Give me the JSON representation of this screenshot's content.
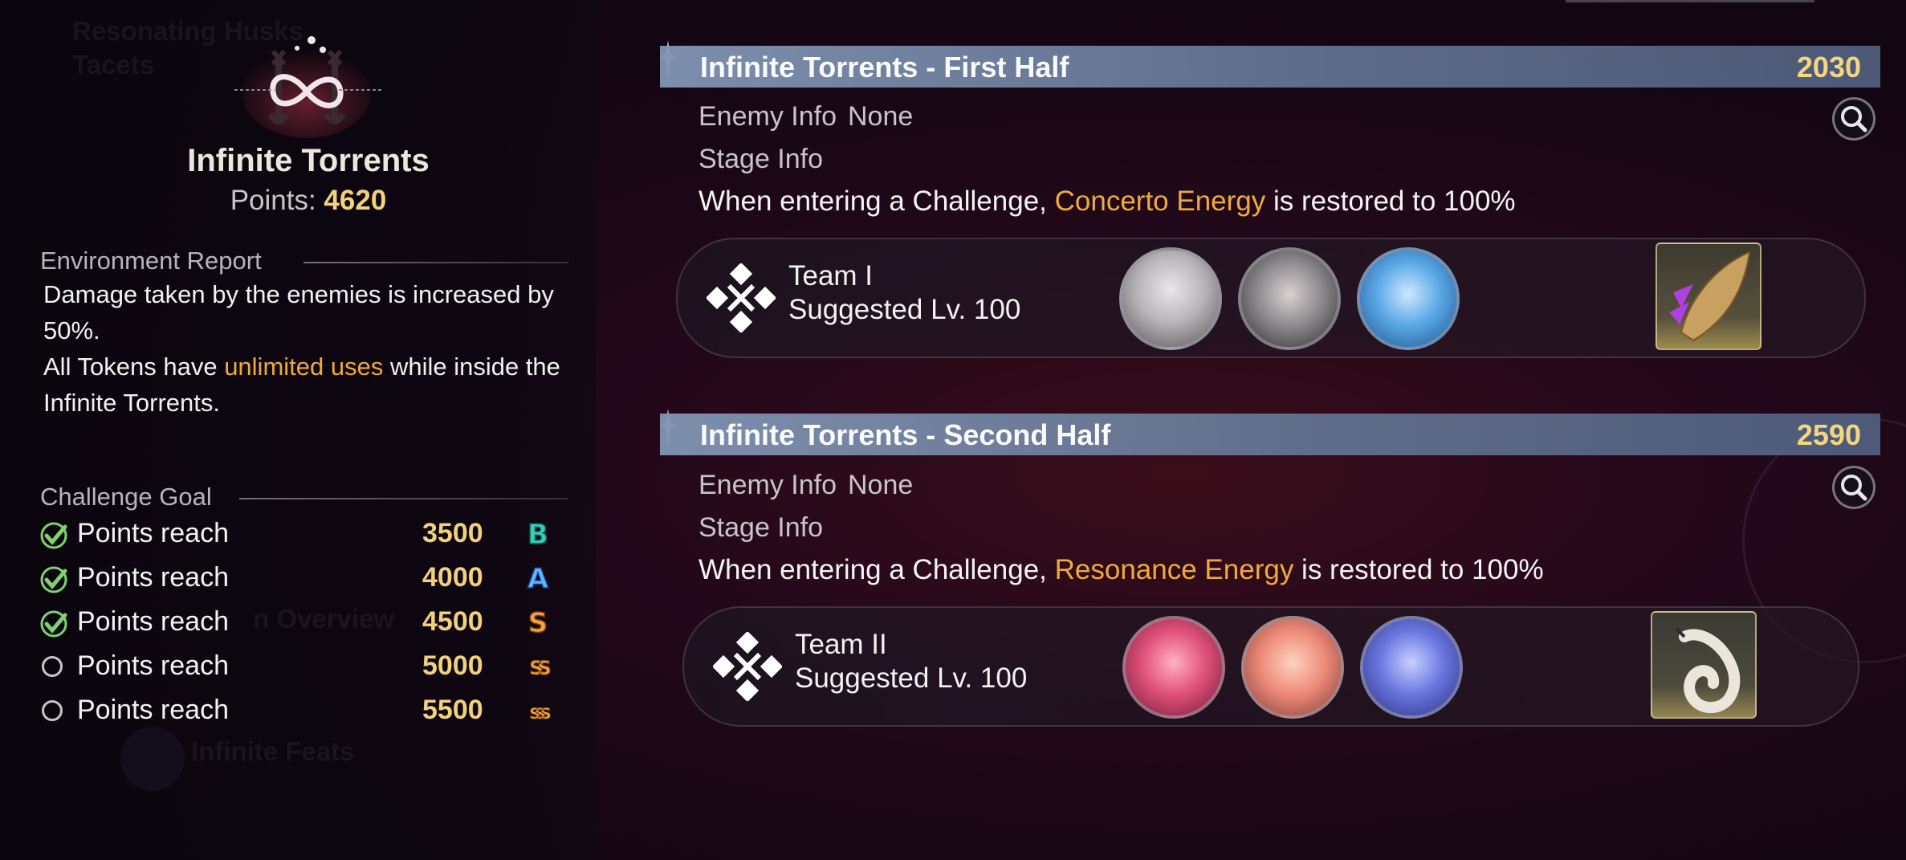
{
  "left": {
    "ghost_texts": [
      "Resonating Husks",
      "Tacets",
      "n Overview",
      "Infinite Feats"
    ],
    "boss": {
      "name": "Infinite Torrents",
      "points_label": "Points:",
      "points_value": "4620"
    },
    "environment": {
      "title": "Environment Report",
      "line1": "Damage taken by the enemies is increased by 50%.",
      "line2_pre": "All Tokens have ",
      "line2_hl": "unlimited uses",
      "line2_post": " while inside the Infinite Torrents."
    },
    "goals": {
      "title": "Challenge Goal",
      "items": [
        {
          "label": "Points reach",
          "value": "3500",
          "rank": "B",
          "done": true
        },
        {
          "label": "Points reach",
          "value": "4000",
          "rank": "A",
          "done": true
        },
        {
          "label": "Points reach",
          "value": "4500",
          "rank": "S",
          "done": true
        },
        {
          "label": "Points reach",
          "value": "5000",
          "rank": "SS",
          "done": false
        },
        {
          "label": "Points reach",
          "value": "5500",
          "rank": "SSS",
          "done": false
        }
      ]
    }
  },
  "stages": [
    {
      "title": "Infinite Torrents - First Half",
      "points": "2030",
      "enemy_label": "Enemy Info",
      "enemy_value": "None",
      "stage_label": "Stage Info",
      "desc_pre": "When entering a Challenge, ",
      "desc_hl": "Concerto Energy",
      "desc_post": " is restored to 100%",
      "team": {
        "name": "Team I",
        "level": "Suggested Lv. 100"
      }
    },
    {
      "title": "Infinite Torrents - Second Half",
      "points": "2590",
      "enemy_label": "Enemy Info",
      "enemy_value": "None",
      "stage_label": "Stage Info",
      "desc_pre": "When entering a Challenge, ",
      "desc_hl": "Resonance Energy",
      "desc_post": " is restored to 100%",
      "team": {
        "name": "Team II",
        "level": "Suggested Lv. 100"
      }
    }
  ],
  "colors": {
    "highlight": "#f0aa3c",
    "points": "#f2d27a",
    "check": "#7dd36c",
    "header": "#8296b4"
  },
  "icons": [
    "search-icon",
    "checkmark-icon",
    "rank-b-icon",
    "rank-a-icon",
    "rank-s-icon",
    "team-emblem-icon"
  ]
}
